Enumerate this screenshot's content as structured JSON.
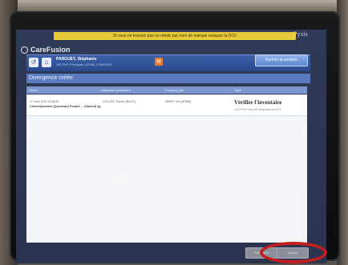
{
  "warning_banner": "Si vous ne trouvez pas un médic par nom de marque essayez la DCI!",
  "brand": "CareFusion",
  "product": "Pyxis",
  "user": {
    "name": "PARGUEY, Stéphanie",
    "subtitle": "192 PH2 Principale (10.06) 17/04/2019"
  },
  "logout_label": "Fermer la session",
  "page_title": "Divergence créée",
  "table": {
    "headers": [
      "Heure",
      "Utilisateur précédent",
      "Trouvé(s) par",
      "Type"
    ],
    "row": {
      "date": "17 mars 2019 14:38:55",
      "med": "Cholestyramine (Questran) Poudre ... (Sachet) 4g",
      "prev_user": "COLLIER, Rachel [RACO]",
      "found_by": "MEIER, Eric [ERME]",
      "type": "Vérifier l'inventaire",
      "location": "192 PH2 Tour d'Entreposement E1"
    }
  },
  "footer": {
    "prev_label": "Précédent",
    "next_label": "Suivant"
  }
}
